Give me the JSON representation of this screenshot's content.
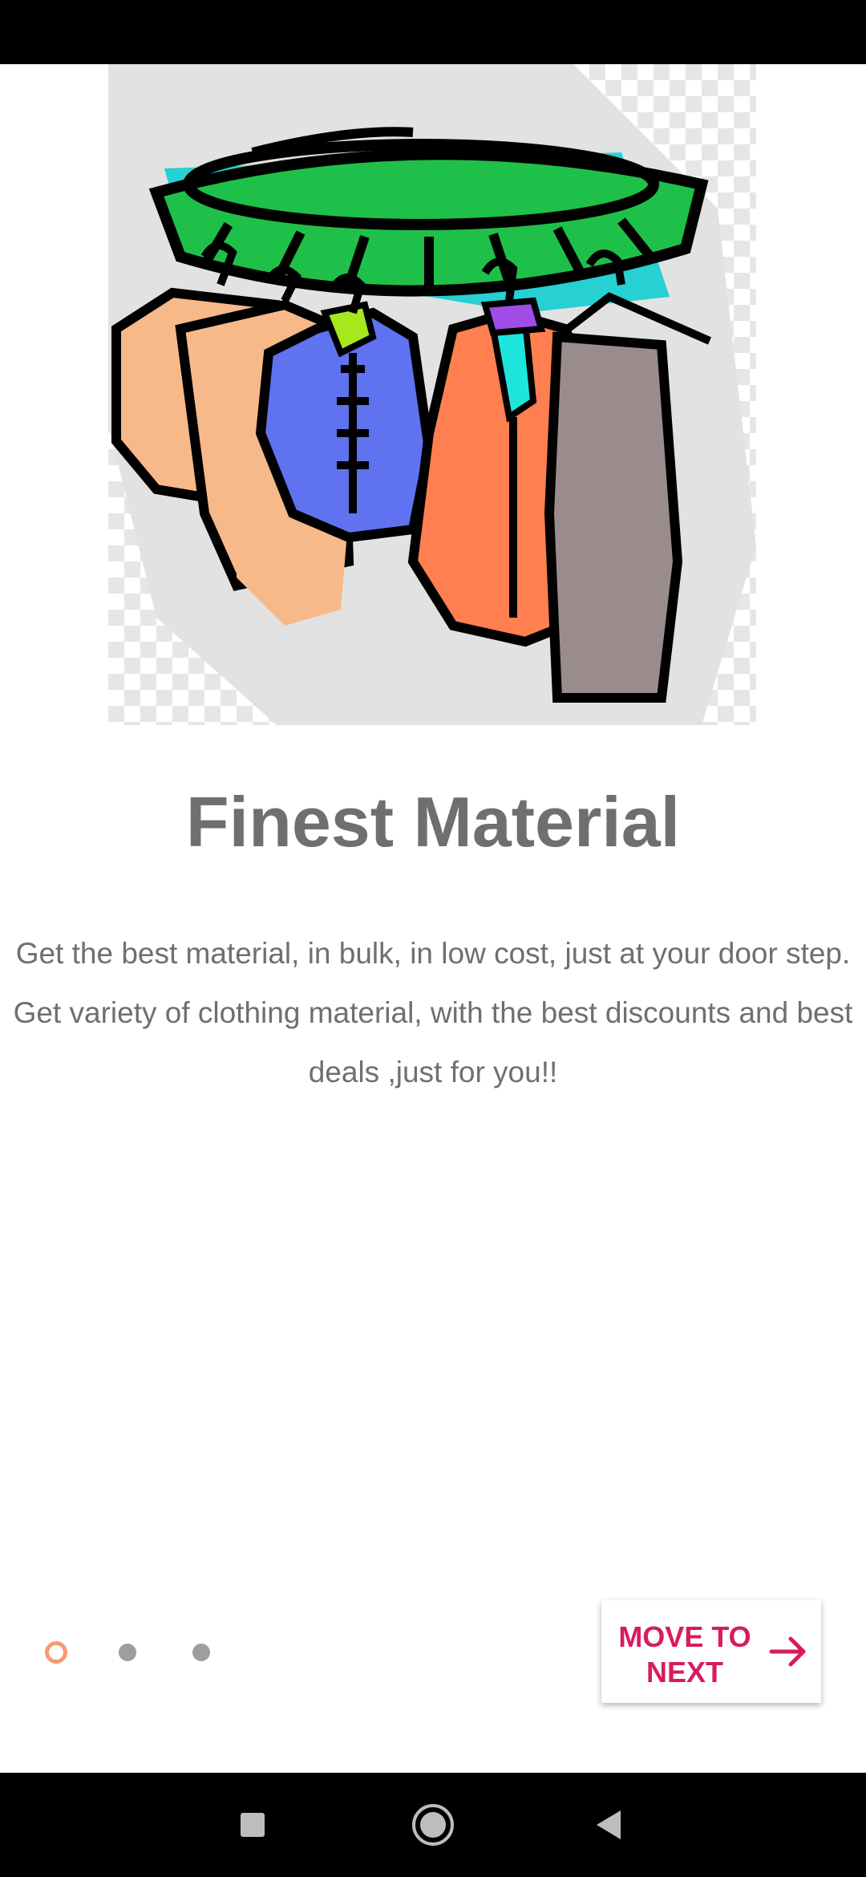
{
  "onboarding": {
    "title": "Finest Material",
    "description": "Get the best material, in bulk, in low cost, just at your door step. Get variety of clothing material, with the best discounts and best deals ,just for you!!",
    "page_indicator": {
      "total": 3,
      "active_index": 0
    },
    "next_button": {
      "label": "MOVE TO NEXT",
      "icon": "arrow-right-icon"
    },
    "colors": {
      "title_text": "#6f6f6f",
      "accent": "#d81b60",
      "active_dot": "#f79a74",
      "inactive_dot": "#9e9e9e"
    }
  },
  "system_nav": {
    "recents_icon": "square-recents-icon",
    "home_icon": "circle-home-icon",
    "back_icon": "triangle-back-icon"
  }
}
